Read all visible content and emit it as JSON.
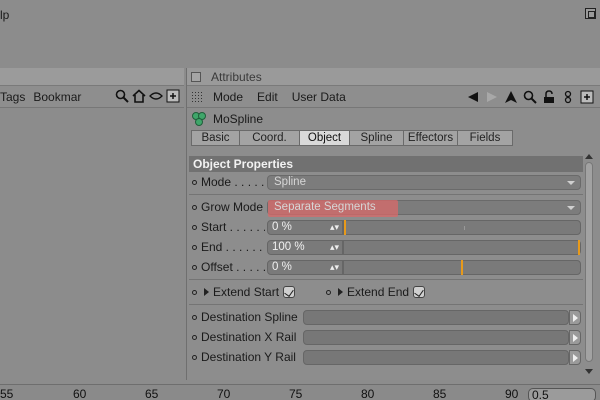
{
  "menubar": {
    "text": "lp"
  },
  "left_panel": {
    "toolbar": [
      "Tags",
      "Bookmar"
    ],
    "row_count": 2
  },
  "attributes": {
    "title": "Attributes",
    "menu": [
      "Mode",
      "Edit",
      "User Data"
    ],
    "object_name": "MoSpline",
    "tabs": [
      {
        "label": "Basic",
        "active": false
      },
      {
        "label": "Coord.",
        "active": false
      },
      {
        "label": "Object",
        "active": true
      },
      {
        "label": "Spline",
        "active": false
      },
      {
        "label": "Effectors",
        "active": false
      },
      {
        "label": "Fields",
        "active": false
      }
    ],
    "section_title": "Object Properties",
    "mode": {
      "label": "Mode . . . . .",
      "value": "Spline"
    },
    "grow_mode": {
      "label": "Grow Mode",
      "value": "Separate Segments"
    },
    "start": {
      "label": "Start . . . . . .",
      "value": "0 %",
      "fraction": 0.0
    },
    "end": {
      "label": "End . . . . . . .",
      "value": "100 %",
      "fraction": 1.0
    },
    "offset": {
      "label": "Offset . . . . .",
      "value": "0 %",
      "fraction": 0.5
    },
    "extend_start": {
      "label": "Extend Start",
      "checked": true
    },
    "extend_end": {
      "label": "Extend End",
      "checked": true
    },
    "destination_spline": {
      "label": "Destination Spline"
    },
    "destination_x_rail": {
      "label": "Destination X Rail"
    },
    "destination_y_rail": {
      "label": "Destination Y Rail"
    }
  },
  "timeline": {
    "numbers": [
      "55",
      "60",
      "65",
      "70",
      "75",
      "80",
      "85",
      "90"
    ],
    "frame_value": "0.5"
  },
  "colors": {
    "accent_orange": "#e89a1a",
    "highlight_red": "#d96a6a",
    "active_tab": "#d9d9d9"
  }
}
